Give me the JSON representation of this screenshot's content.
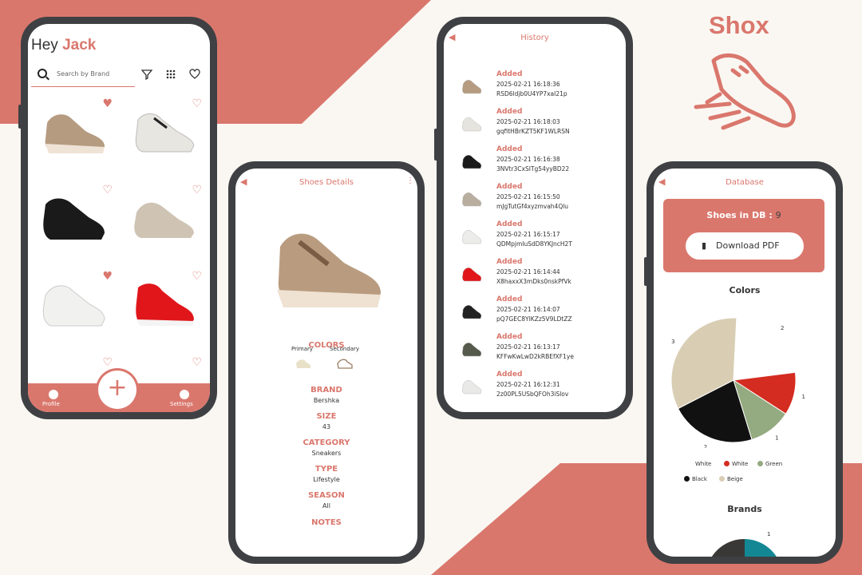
{
  "brand": {
    "title": "Shox",
    "color": "#da776d"
  },
  "home": {
    "greeting": "Hey",
    "user_name": "Jack",
    "search_placeholder": "Search by Brand",
    "tabs": {
      "profile": "Profile",
      "settings": "Settings"
    },
    "add_symbol": "+"
  },
  "details": {
    "title": "Shoes Details",
    "colors_label": "COLORS",
    "primary_label": "Primary",
    "secondary_label": "Secondary",
    "brand_label": "BRAND",
    "brand_value": "Bershka",
    "size_label": "SIZE",
    "size_value": "43",
    "category_label": "CATEGORY",
    "category_value": "Sneakers",
    "type_label": "TYPE",
    "type_value": "Lifestyle",
    "season_label": "SEASON",
    "season_value": "All",
    "notes_label": "NOTES"
  },
  "history": {
    "title": "History",
    "items": [
      {
        "status": "Added",
        "time": "2025-02-21 16:18:36",
        "id": "RSD6ldjb0U4YP7xaI21p"
      },
      {
        "status": "Added",
        "time": "2025-02-21 16:18:03",
        "id": "gqfitHBrKZT5KF1WLRSN"
      },
      {
        "status": "Added",
        "time": "2025-02-21 16:16:38",
        "id": "3NVtr3CxSITg54yyBD22"
      },
      {
        "status": "Added",
        "time": "2025-02-21 16:15:50",
        "id": "mJgTutGf4xyzmvah4Qlu"
      },
      {
        "status": "Added",
        "time": "2025-02-21 16:15:17",
        "id": "QDMpjmIuSdD8YKJncH2T"
      },
      {
        "status": "Added",
        "time": "2025-02-21 16:14:44",
        "id": "X8haxxX3mDks0nskPfVk"
      },
      {
        "status": "Added",
        "time": "2025-02-21 16:14:07",
        "id": "pQ7GEC8YIKZz5V9LDtZZ"
      },
      {
        "status": "Added",
        "time": "2025-02-21 16:13:17",
        "id": "KFFwKwLwD2kRBEfXF1ye"
      },
      {
        "status": "Added",
        "time": "2025-02-21 16:12:31",
        "id": "2z00PL5USbQFOh3iSlov"
      }
    ]
  },
  "database": {
    "title": "Database",
    "count_label": "Shoes in DB :",
    "count_value": "9",
    "download_label": "Download PDF",
    "colors_title": "Colors",
    "brands_title": "Brands"
  },
  "chart_data": [
    {
      "type": "pie",
      "title": "Colors",
      "slices": [
        {
          "label": "White",
          "value": 2,
          "color": "#ffffff"
        },
        {
          "label": "White",
          "value": 1,
          "color": "#d42c20"
        },
        {
          "label": "Green",
          "value": 1,
          "color": "#94aa80"
        },
        {
          "label": "Black",
          "value": 2,
          "color": "#111111"
        },
        {
          "label": "Beige",
          "value": 3,
          "color": "#d9ceb4"
        }
      ],
      "legend_placement": "bottom"
    },
    {
      "type": "pie",
      "title": "Brands",
      "visible_labels": [
        "1"
      ]
    }
  ]
}
